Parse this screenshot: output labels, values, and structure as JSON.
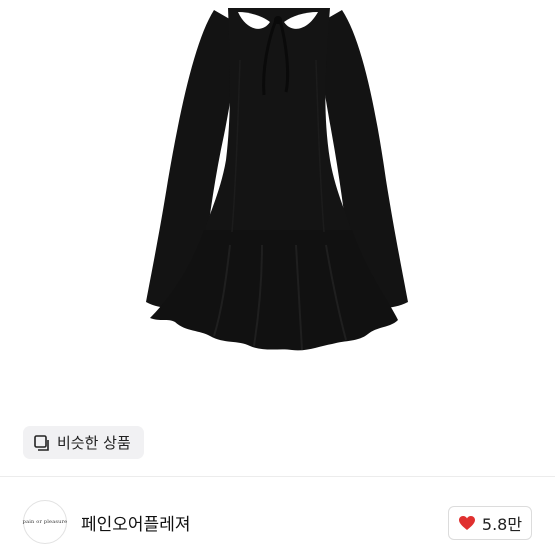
{
  "product": {
    "image_alt": "black mini dress with bell sleeves",
    "similar_button_label": "비슷한 상품"
  },
  "store": {
    "name": "페인오어플레져",
    "avatar_text": "pain or pleasure",
    "likes_label": "5.8만"
  },
  "colors": {
    "dress": "#121212",
    "like_heart": "#e0302f",
    "chip_bg": "#f1f1f3"
  }
}
